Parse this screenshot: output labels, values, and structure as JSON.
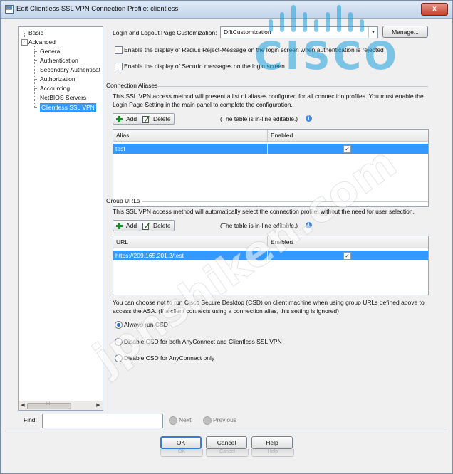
{
  "window": {
    "title": "Edit Clientless SSL VPN Connection Profile: clientless",
    "close_label": "x"
  },
  "nav": {
    "items": [
      {
        "label": "Basic"
      },
      {
        "label": "Advanced"
      },
      {
        "label": "General"
      },
      {
        "label": "Authentication"
      },
      {
        "label": "Secondary Authenticat"
      },
      {
        "label": "Authorization"
      },
      {
        "label": "Accounting"
      },
      {
        "label": "NetBIOS Servers"
      },
      {
        "label": "Clientless SSL VPN"
      }
    ],
    "expander": "-",
    "scroll_left": "◀",
    "scroll_right": "▶",
    "scroll_grip": "III"
  },
  "login": {
    "label": "Login and Logout Page Customization:",
    "value": "DfltCustomization",
    "manage_label": "Manage...",
    "opt_radius": "Enable the display of Radius Reject-Message on the login screen when authentication is rejected",
    "opt_securid": "Enable the display of SecurId messages on the login screen"
  },
  "aliases": {
    "section": "Connection Aliases",
    "desc": "This SSL VPN access method will present a list of aliases configured for all connection profiles. You must enable the Login Page Setting in the main panel to complete the configuration.",
    "add": "Add",
    "delete": "Delete",
    "hint": "(The table is in-line editable.)",
    "columns": [
      "Alias",
      "Enabled"
    ],
    "rows": [
      {
        "alias": "test",
        "enabled": true
      }
    ]
  },
  "group_urls": {
    "section": "Group URLs",
    "desc": "This SSL VPN access method will automatically select the connection profile, without the need for user selection.",
    "add": "Add",
    "delete": "Delete",
    "hint": "(The table is in-line editable.)",
    "columns": [
      "URL",
      "Enabled"
    ],
    "rows": [
      {
        "url": "https://209.165.201.2/test",
        "enabled": true
      }
    ]
  },
  "csd": {
    "desc": "You can choose not to run Cisco Secure Desktop (CSD) on client machine when using group URLs defined above to access the ASA. (If a client connects using a connection alias, this setting is ignored)",
    "options": [
      {
        "label": "Always run CSD",
        "selected": true
      },
      {
        "label": "Disable CSD for both AnyConnect and Clientless SSL VPN",
        "selected": false
      },
      {
        "label": "Disable CSD for AnyConnect only",
        "selected": false
      }
    ]
  },
  "find": {
    "label": "Find:",
    "value": "",
    "next": "Next",
    "previous": "Previous"
  },
  "buttons": {
    "ok": "OK",
    "cancel": "Cancel",
    "help": "Help"
  },
  "overlays": {
    "watermark": "jpnshiken.com",
    "logo_text": "CISCO"
  },
  "colors": {
    "selection": "#3399ff",
    "logo": "#1ea0dc"
  }
}
